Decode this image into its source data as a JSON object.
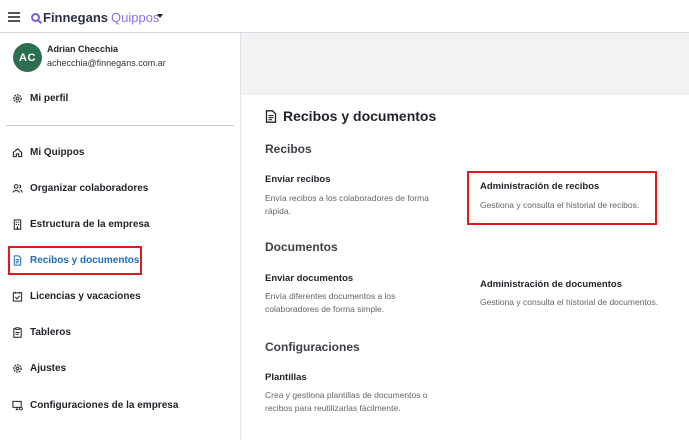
{
  "brand": {
    "name_primary": "Finnegans",
    "name_secondary": "Quippos",
    "accent": "#8f6fe0"
  },
  "user": {
    "initials": "AC",
    "name": "Adrian Checchia",
    "email": "achecchia@finnegans.com.ar",
    "avatar_color": "#2c6e4f"
  },
  "sidebar": {
    "profile": {
      "label": "Mi perfil",
      "icon": "gear-icon"
    },
    "items": [
      {
        "label": "Mi Quippos",
        "icon": "home-icon"
      },
      {
        "label": "Organizar colaboradores",
        "icon": "people-icon"
      },
      {
        "label": "Estructura de la empresa",
        "icon": "building-icon"
      },
      {
        "label": "Recibos y documentos",
        "icon": "document-icon",
        "active": true
      },
      {
        "label": "Licencias y vacaciones",
        "icon": "calendar-check-icon"
      },
      {
        "label": "Tableros",
        "icon": "clipboard-icon"
      },
      {
        "label": "Ajustes",
        "icon": "gear-icon"
      },
      {
        "label": "Configuraciones de la empresa",
        "icon": "monitor-gear-icon"
      }
    ],
    "active_color": "#1e6fb8"
  },
  "main": {
    "title": "Recibos y documentos",
    "sections": [
      {
        "title": "Recibos",
        "cards": [
          {
            "title": "Enviar recibos",
            "desc_line1": "Envía recibos a los colaboradores de forma",
            "desc_line2": "rápida."
          },
          {
            "title": "Administración de recibos",
            "desc_line1": "Gestiona y consulta el historial de recibos."
          }
        ]
      },
      {
        "title": "Documentos",
        "cards": [
          {
            "title": "Enviar documentos",
            "desc_line1": "Envía diferentes documentos a los",
            "desc_line2": "colaboradores de forma simple."
          },
          {
            "title": "Administración de documentos",
            "desc_line1": "Gestiona y consulta el historial de documentos."
          }
        ]
      },
      {
        "title": "Configuraciones",
        "cards": [
          {
            "title": "Plantillas",
            "desc_line1": "Crea y gestiona plantillas de documentos o",
            "desc_line2": "recibos para reutilizarlas fácilmente."
          }
        ]
      }
    ]
  },
  "highlight_color": "#e0191e"
}
